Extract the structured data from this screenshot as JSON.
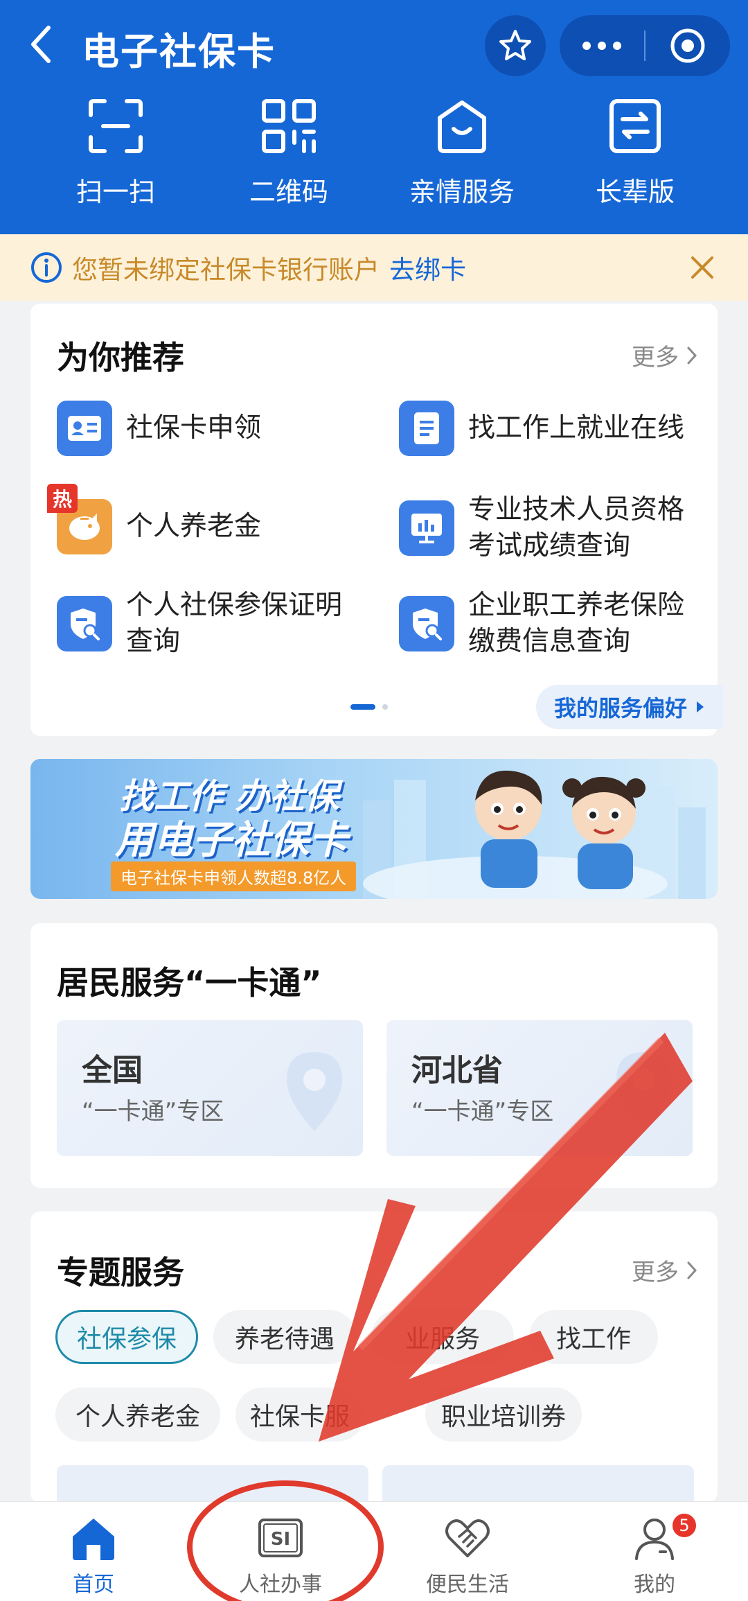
{
  "header": {
    "title": "电子社保卡",
    "quick_actions": [
      {
        "label": "扫一扫",
        "icon": "scan-icon"
      },
      {
        "label": "二维码",
        "icon": "qrcode-icon"
      },
      {
        "label": "亲情服务",
        "icon": "family-service-icon"
      },
      {
        "label": "长辈版",
        "icon": "elder-mode-icon"
      }
    ]
  },
  "notice": {
    "text": "您暂未绑定社保卡银行账户",
    "link": "去绑卡"
  },
  "recommend": {
    "title": "为你推荐",
    "more": "更多",
    "items": [
      {
        "label": "社保卡申领",
        "icon": "id-card-icon",
        "color": "#3d7ee6"
      },
      {
        "label": "找工作上就业在线",
        "icon": "document-icon",
        "color": "#3d7ee6"
      },
      {
        "label": "个人养老金",
        "icon": "piggy-bank-icon",
        "color": "#f0a242",
        "badge": "热"
      },
      {
        "label_line1": "专业技术人员资格",
        "label_line2": "考试成绩查询",
        "icon": "presentation-icon",
        "color": "#3d7ee6"
      },
      {
        "label_line1": "个人社保参保证明",
        "label_line2": "查询",
        "icon": "shield-search-icon",
        "color": "#3d7ee6"
      },
      {
        "label_line1": "企业职工养老保险",
        "label_line2": "缴费信息查询",
        "icon": "shield-search-icon",
        "color": "#3d7ee6"
      }
    ],
    "preference_button": "我的服务偏好"
  },
  "banner": {
    "line1": "找工作 办社保",
    "line2": "用电子社保卡",
    "line3": "电子社保卡申领人数超8.8亿人"
  },
  "resident": {
    "title": "居民服务“一卡通”",
    "regions": [
      {
        "name": "全国",
        "sub": "“一卡通”专区"
      },
      {
        "name": "河北省",
        "sub": "“一卡通”专区"
      }
    ]
  },
  "topics": {
    "title": "专题服务",
    "more": "更多",
    "chips": [
      "社保参保",
      "养老待遇",
      "业服务",
      "找工作",
      "个人养老金",
      "社保卡服",
      "职业培训券"
    ]
  },
  "tabbar": {
    "tabs": [
      {
        "label": "首页",
        "icon": "home-icon"
      },
      {
        "label": "人社办事",
        "icon": "si-icon"
      },
      {
        "label": "便民生活",
        "icon": "handshake-icon"
      },
      {
        "label": "我的",
        "icon": "user-icon",
        "badge": "5"
      }
    ]
  },
  "colors": {
    "primary": "#1667d6",
    "notice_bg": "#fdf1da",
    "notice_text": "#c88a2a",
    "hot": "#e6352b",
    "annotation_red": "#e03a2c"
  }
}
